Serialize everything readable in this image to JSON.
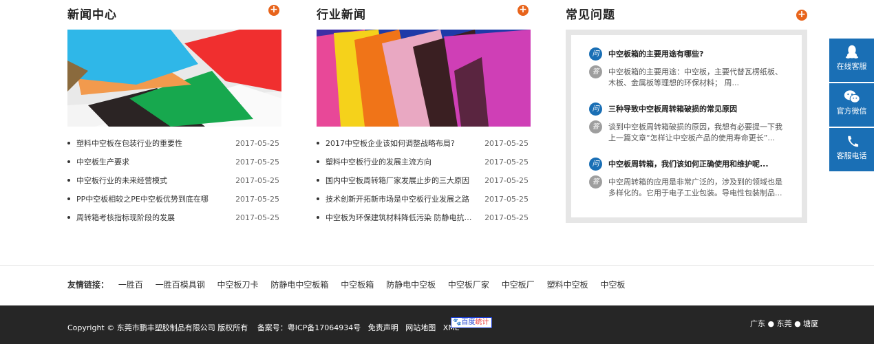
{
  "news": {
    "title": "新闻中心",
    "more_icon": "plus-circle-icon",
    "items": [
      {
        "text": "塑料中空板在包装行业的重要性",
        "date": "2017-05-25"
      },
      {
        "text": "中空板生产要求",
        "date": "2017-05-25"
      },
      {
        "text": "中空板行业的未来经营模式",
        "date": "2017-05-25"
      },
      {
        "text": "PP中空板相较之PE中空板优势到底在哪",
        "date": "2017-05-25"
      },
      {
        "text": "周转箱考核指标现阶段的发展",
        "date": "2017-05-25"
      }
    ]
  },
  "industry": {
    "title": "行业新闻",
    "more_icon": "plus-circle-icon",
    "items": [
      {
        "text": "2017中空板企业该如何调整战略布局?",
        "date": "2017-05-25"
      },
      {
        "text": "塑料中空板行业的发展主流方向",
        "date": "2017-05-25"
      },
      {
        "text": "国内中空板周转箱厂家发展止步的三大原因",
        "date": "2017-05-25"
      },
      {
        "text": "技术创新开拓新市场是中空板行业发展之路",
        "date": "2017-05-25"
      },
      {
        "text": "中空板为环保建筑材料降低污染 防静电抗老...",
        "date": "2017-05-25"
      }
    ]
  },
  "faq": {
    "title": "常见问题",
    "q_badge": "问",
    "a_badge": "答",
    "items": [
      {
        "q": "中空板箱的主要用途有哪些?",
        "a": "中空板箱的主要用途：中空板，主要代替瓦楞纸板、木板、金属板等理想的环保材料；  周..."
      },
      {
        "q": "三种导致中空板周转箱破损的常见原因",
        "a": "谈到中空板周转箱破损的原因，我想有必要提一下我上一篇文章“怎样让中空板产品的使用寿命更长”..."
      },
      {
        "q": "中空板周转箱，我们该如何正确使用和维护呢...",
        "a": "中空周转箱的应用是非常广泛的，涉及到的领域也是多样化的。它用于电子工业包装。导电性包装制品..."
      }
    ]
  },
  "side": {
    "items": [
      {
        "label": "在线客服",
        "icon": "qq-icon"
      },
      {
        "label": "官方微信",
        "icon": "wechat-icon"
      },
      {
        "label": "客服电话",
        "icon": "phone-icon"
      }
    ]
  },
  "links": {
    "label": "友情链接：",
    "items": [
      "一胜百",
      "一胜百模具钢",
      "中空板刀卡",
      "防静电中空板箱",
      "中空板箱",
      "防静电中空板",
      "中空板厂家",
      "中空板厂",
      "塑料中空板",
      "中空板"
    ]
  },
  "footer": {
    "copyright": "Copyright © 东莞市鹏丰塑胶制品有限公司 版权所有",
    "icp": "备案号：粤ICP备17064934号",
    "disclaimer": "免责声明",
    "sitemap": "网站地图",
    "xml": "XML",
    "tongji_a": "百度",
    "tongji_b": "统计",
    "region": "广东 ● 东莞 ● 塘厦"
  },
  "colors": {
    "accent_orange": "#e8641b",
    "brand_blue": "#1a6fb5",
    "footer_bg": "#262626"
  }
}
